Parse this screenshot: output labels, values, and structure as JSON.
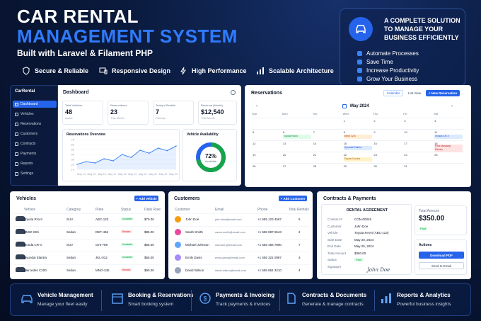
{
  "hero": {
    "line1": "CAR RENTAL",
    "line2": "MANAGEMENT SYSTEM",
    "subtitle": "Built with Laravel & Filament PHP",
    "features": [
      "Secure & Reliable",
      "Responsive Design",
      "High Performance",
      "Scalable Architecture"
    ]
  },
  "promo": {
    "heading_line1": "A COMPLETE SOLUTION",
    "heading_line2": "TO MANAGE YOUR",
    "heading_line3": "BUSINESS EFFICIENTLY",
    "bullets": [
      "Automate Processes",
      "Save Time",
      "Increase Productivity",
      "Grow Your Business"
    ]
  },
  "sidebar": {
    "brand": "CarRental",
    "items": [
      "Dashboard",
      "Vehicles",
      "Reservations",
      "Customers",
      "Contracts",
      "Payments",
      "Reports",
      "Settings"
    ]
  },
  "dashboard": {
    "title": "Dashboard",
    "stats": [
      {
        "label": "Total Vehicles",
        "value": "48",
        "sub": "Active"
      },
      {
        "label": "Reservations",
        "value": "23",
        "sub": "This Month"
      },
      {
        "label": "Today's Rentals",
        "value": "7",
        "sub": "Pickups"
      },
      {
        "label": "Revenue (Month)",
        "value": "$12,540",
        "sub": "This Month"
      }
    ],
    "overview_title": "Reservations Overview",
    "availability_title": "Vehicle Availability",
    "availability_pct": "72%",
    "availability_label": "Available",
    "availability_value": 0.72
  },
  "chart_data": {
    "type": "line",
    "x": [
      "May 14",
      "May 15",
      "May 16",
      "May 17",
      "May 18",
      "May 19",
      "May 20",
      "May 21",
      "May 22",
      "May 23"
    ],
    "y_ticks": [
      "70",
      "60",
      "50",
      "40",
      "30",
      "20",
      "10"
    ],
    "values": [
      12,
      18,
      15,
      25,
      20,
      35,
      28,
      45,
      38,
      50,
      44,
      55
    ]
  },
  "reservations": {
    "title": "Reservations",
    "view_calendar": "Calendar",
    "view_list": "List View",
    "new_button": "+ New Reservation",
    "month": "May 2024",
    "days": [
      "Sun",
      "Mon",
      "Tue",
      "Wed",
      "Thu",
      "Fri",
      "Sat"
    ],
    "weeks": [
      [
        "",
        "",
        "",
        "1",
        "2",
        "3",
        "4"
      ],
      [
        "5",
        "6",
        "7",
        "8",
        "9",
        "10",
        "11"
      ],
      [
        "12",
        "13",
        "14",
        "15",
        "16",
        "17",
        "18"
      ],
      [
        "19",
        "20",
        "21",
        "22",
        "23",
        "24",
        "25"
      ],
      [
        "26",
        "27",
        "28",
        "29",
        "30",
        "31",
        ""
      ]
    ],
    "events": [
      "Toyota RAV4",
      "BMW 320i",
      "Honda CR-V",
      "Hyundai Elantra",
      "Ford Mustang",
      "Return",
      "Toyota Corolla"
    ]
  },
  "vehicles": {
    "title": "Vehicles",
    "add_button": "+ Add Vehicle",
    "headers": [
      "Vehicle",
      "Category",
      "Plate",
      "Status",
      "Daily Rate"
    ],
    "rows": [
      [
        "Toyota RAV4",
        "SUV",
        "ABC-123",
        "Available",
        "$70.00"
      ],
      [
        "BMW 320i",
        "Sedan",
        "DEF-456",
        "Rented",
        "$85.00"
      ],
      [
        "Honda CR-V",
        "SUV",
        "GHI-789",
        "Available",
        "$65.00"
      ],
      [
        "Hyundai Elantra",
        "Sedan",
        "JKL-012",
        "Available",
        "$55.00"
      ],
      [
        "Mercedes C200",
        "Sedan",
        "MNO-345",
        "Rented",
        "$90.00"
      ]
    ]
  },
  "customers": {
    "title": "Customers",
    "add_button": "+ Add Customer",
    "headers": [
      "Customer",
      "Email",
      "Phone",
      "Total Rentals"
    ],
    "rows": [
      [
        "John Doe",
        "john.doe@email.com",
        "+1 555 123 4567",
        "5"
      ],
      [
        "Sarah Smith",
        "sarah.smith@email.com",
        "+1 555 987 6543",
        "2"
      ],
      [
        "Michael Johnson",
        "michael.j@email.com",
        "+1 555 456 7890",
        "7"
      ],
      [
        "Emily Davis",
        "emily.davis@email.com",
        "+1 555 321 0987",
        "3"
      ],
      [
        "David Wilson",
        "david.wilson@email.com",
        "+1 555 654 3210",
        "4"
      ]
    ]
  },
  "contracts": {
    "title": "Contracts & Payments",
    "agreement_title": "RENTAL AGREEMENT",
    "fields": [
      [
        "Contract #",
        "CON-00045"
      ],
      [
        "Customer",
        "John Doe"
      ],
      [
        "Vehicle",
        "Toyota RAV4 (ABC-123)"
      ],
      [
        "Start Date",
        "May 20, 2024"
      ],
      [
        "End Date",
        "May 25, 2024"
      ],
      [
        "Total Amount",
        "$350.00"
      ],
      [
        "Status",
        "Paid"
      ],
      [
        "Signature",
        ""
      ]
    ],
    "signature": "John Doe",
    "total_label": "Total Amount",
    "total_value": "$350.00",
    "paid_badge": "Paid",
    "actions_label": "Actions",
    "download": "Download PDF",
    "email": "Send to Email"
  },
  "bottom": [
    {
      "title": "Vehicle Management",
      "sub": "Manage your fleet easily"
    },
    {
      "title": "Booking & Reservations",
      "sub": "Smart booking system"
    },
    {
      "title": "Payments & Invoicing",
      "sub": "Track payments & invoices"
    },
    {
      "title": "Contracts & Documents",
      "sub": "Generate & manage contracts"
    },
    {
      "title": "Reports & Analytics",
      "sub": "Powerful business insights"
    }
  ],
  "colors": {
    "accent": "#2563eb",
    "green": "#16a34a",
    "red": "#dc2626",
    "navy": "#0b1a3c"
  }
}
